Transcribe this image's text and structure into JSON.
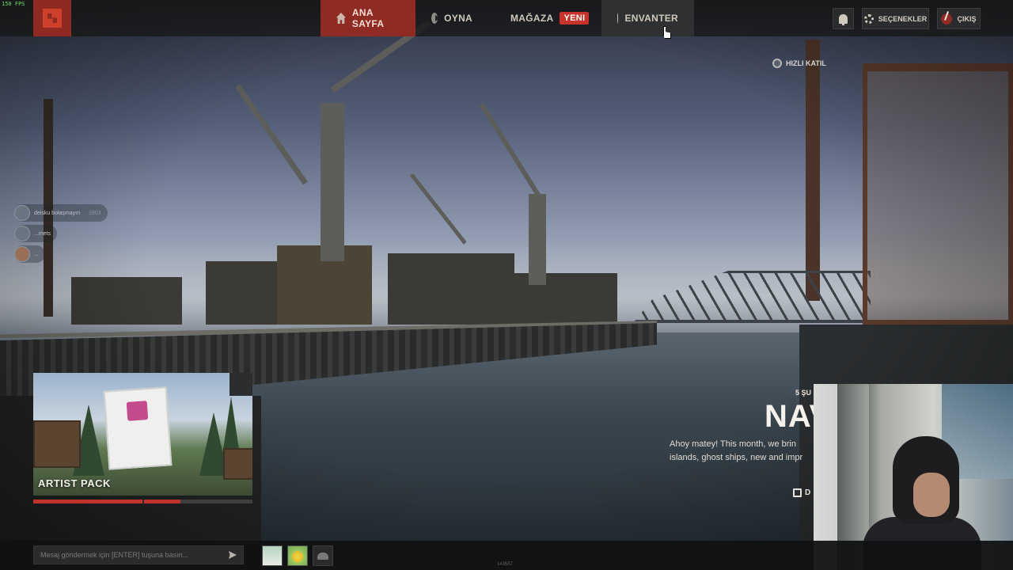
{
  "app": {
    "fps": "150 FPS",
    "build": "143657"
  },
  "topbar": {
    "nav": [
      {
        "id": "home",
        "label": "ANA SAYFA",
        "icon": "home-icon",
        "active": true
      },
      {
        "id": "play",
        "label": "OYNA",
        "icon": "play-icon"
      },
      {
        "id": "store",
        "label": "MAĞAZA",
        "icon": "store-icon",
        "badge": "YENI"
      },
      {
        "id": "inventory",
        "label": "ENVANTER",
        "icon": "inventory-icon",
        "hover": true
      }
    ],
    "options_label": "SEÇENEKLER",
    "quit_label": "ÇIKIŞ"
  },
  "quick_join": {
    "label": "HIZLI KATIL"
  },
  "friends": [
    {
      "name": "deisku bolaşmayın",
      "status": "1903"
    },
    {
      "name": "...mets"
    },
    {
      "name": "..."
    }
  ],
  "promo": {
    "title": "ARTIST PACK",
    "progress": 0.67
  },
  "news": {
    "date": "5 ŞU",
    "title": "NAV",
    "body_line1": "Ahoy matey! This month, we brin",
    "body_line2": "islands, ghost ships, new and impr",
    "link": "D"
  },
  "chat": {
    "placeholder": "Mesaj göndermek için [ENTER] tuşuna basın..."
  },
  "colors": {
    "accent": "#8f2b23",
    "badge": "#c7322a",
    "progress": "#c0332b"
  }
}
